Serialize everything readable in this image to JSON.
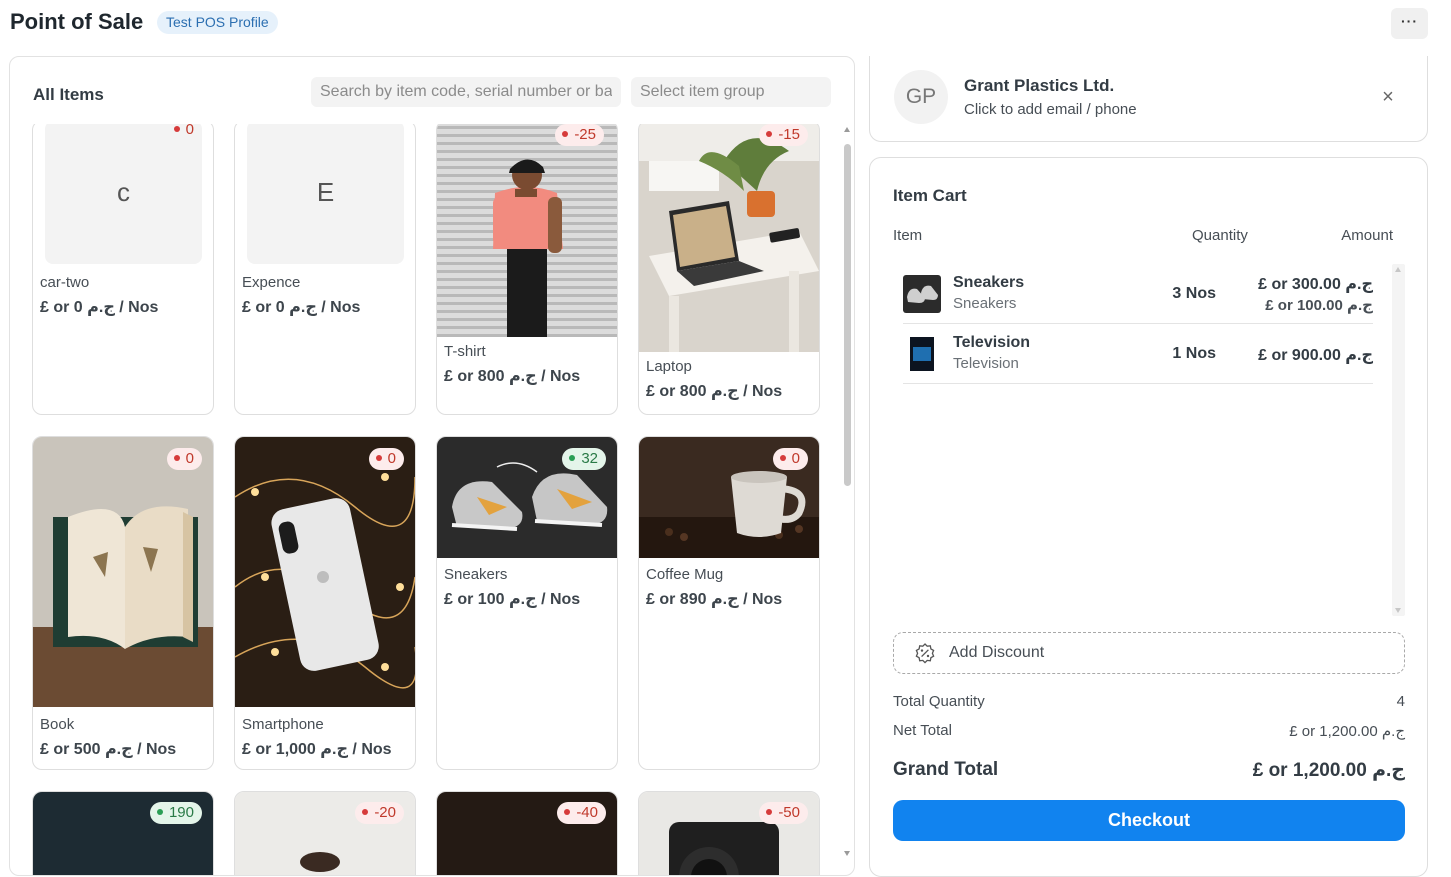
{
  "header": {
    "title": "Point of Sale",
    "profile_badge": "Test POS Profile",
    "more_label": "···"
  },
  "items_panel": {
    "title": "All Items",
    "search_placeholder": "Search by item code, serial number or barcode",
    "group_placeholder": "Select item group",
    "items": [
      {
        "name": "car-two",
        "price": "£ or 0 ج.م / Nos",
        "stock": "0",
        "stock_status": "red",
        "image": "letter",
        "letter": "c"
      },
      {
        "name": "Expence",
        "price": "£ or 0 ج.م / Nos",
        "stock": "",
        "stock_status": "none",
        "image": "letter",
        "letter": "E"
      },
      {
        "name": "T-shirt",
        "price": "£ or 800 ج.م / Nos",
        "stock": "-25",
        "stock_status": "red",
        "image": "tshirt-photo"
      },
      {
        "name": "Laptop",
        "price": "£ or 800 ج.م / Nos",
        "stock": "-15",
        "stock_status": "red",
        "image": "laptop-photo"
      },
      {
        "name": "Book",
        "price": "£ or 500 ج.م / Nos",
        "stock": "0",
        "stock_status": "red",
        "image": "book-photo"
      },
      {
        "name": "Smartphone",
        "price": "£ or 1,000 ج.م / Nos",
        "stock": "0",
        "stock_status": "red",
        "image": "phone-photo"
      },
      {
        "name": "Sneakers",
        "price": "£ or 100 ج.م / Nos",
        "stock": "32",
        "stock_status": "green",
        "image": "sneakers-photo"
      },
      {
        "name": "Coffee Mug",
        "price": "£ or 890 ج.م / Nos",
        "stock": "0",
        "stock_status": "red",
        "image": "mug-photo"
      },
      {
        "name": "",
        "price": "",
        "stock": "190",
        "stock_status": "green",
        "image": "dark-photo"
      },
      {
        "name": "",
        "price": "",
        "stock": "-20",
        "stock_status": "red",
        "image": "light-photo"
      },
      {
        "name": "",
        "price": "",
        "stock": "-40",
        "stock_status": "red",
        "image": "dark-photo"
      },
      {
        "name": "",
        "price": "",
        "stock": "-50",
        "stock_status": "red",
        "image": "camera-photo"
      }
    ]
  },
  "customer": {
    "initials": "GP",
    "name": "Grant Plastics Ltd.",
    "contact_hint": "Click to add email / phone",
    "close_icon": "×"
  },
  "cart": {
    "title": "Item Cart",
    "columns": {
      "item": "Item",
      "quantity": "Quantity",
      "amount": "Amount"
    },
    "rows": [
      {
        "name": "Sneakers",
        "sub": "Sneakers",
        "qty": "3 Nos",
        "amount": "£ or 300.00 ج.م",
        "rate": "£ or 100.00 ج.م"
      },
      {
        "name": "Television",
        "sub": "Television",
        "qty": "1 Nos",
        "amount": "£ or 900.00 ج.م",
        "rate": ""
      }
    ],
    "discount_label": "Add Discount",
    "totals": {
      "total_quantity_label": "Total Quantity",
      "total_quantity": "4",
      "net_total_label": "Net Total",
      "net_total": "£ or 1,200.00 ج.م",
      "grand_total_label": "Grand Total",
      "grand_total": "£ or 1,200.00 ج.م"
    },
    "checkout_label": "Checkout"
  },
  "colors": {
    "accent": "#1183ef",
    "stock_negative": "#c0392b",
    "stock_positive": "#2a7a47"
  }
}
